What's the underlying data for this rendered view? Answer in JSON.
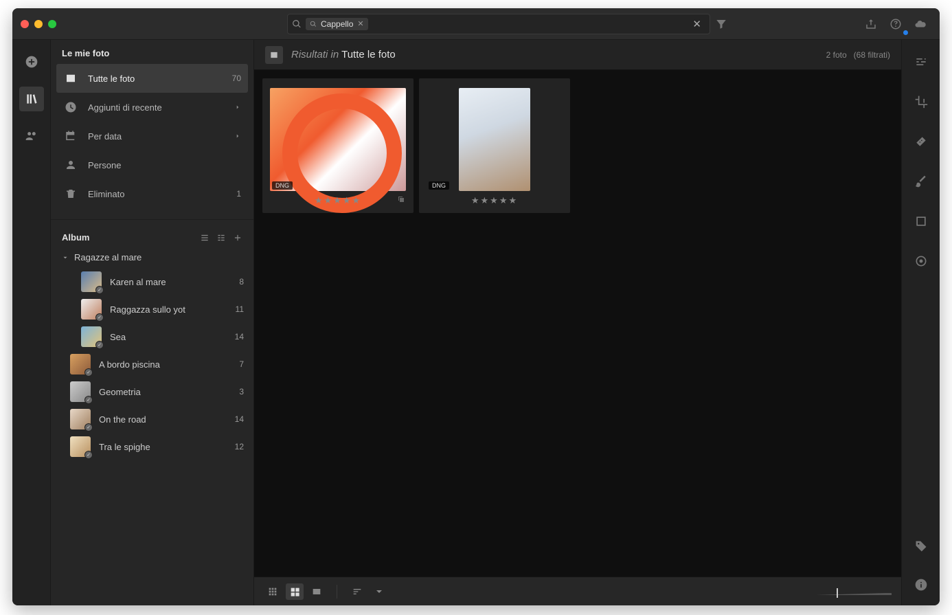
{
  "search": {
    "tag": "Cappello"
  },
  "sidebar_title": "Le mie foto",
  "nav": [
    {
      "label": "Tutte le foto",
      "count": "70",
      "icon": "photos"
    },
    {
      "label": "Aggiunti di recente",
      "icon": "clock",
      "chevron": true
    },
    {
      "label": "Per data",
      "icon": "calendar",
      "chevron": true
    },
    {
      "label": "Persone",
      "icon": "person"
    },
    {
      "label": "Eliminato",
      "icon": "trash",
      "count": "1"
    }
  ],
  "albums_header": "Album",
  "folder": {
    "name": "Ragazze al mare"
  },
  "albums": {
    "children": [
      {
        "label": "Karen al mare",
        "count": "8"
      },
      {
        "label": "Raggazza sullo yot",
        "count": "11"
      },
      {
        "label": "Sea",
        "count": "14"
      }
    ],
    "top": [
      {
        "label": "A bordo piscina",
        "count": "7"
      },
      {
        "label": "Geometria",
        "count": "3"
      },
      {
        "label": "On the road",
        "count": "14"
      },
      {
        "label": "Tra le spighe",
        "count": "12"
      }
    ]
  },
  "results": {
    "prefix": "Risultati in",
    "scope": "Tutte le foto",
    "count_label": "2 foto",
    "filtered_label": "(68 filtrati)"
  },
  "photos": [
    {
      "badge": "DNG",
      "has_stack": true
    },
    {
      "badge": "DNG",
      "has_stack": false
    }
  ]
}
